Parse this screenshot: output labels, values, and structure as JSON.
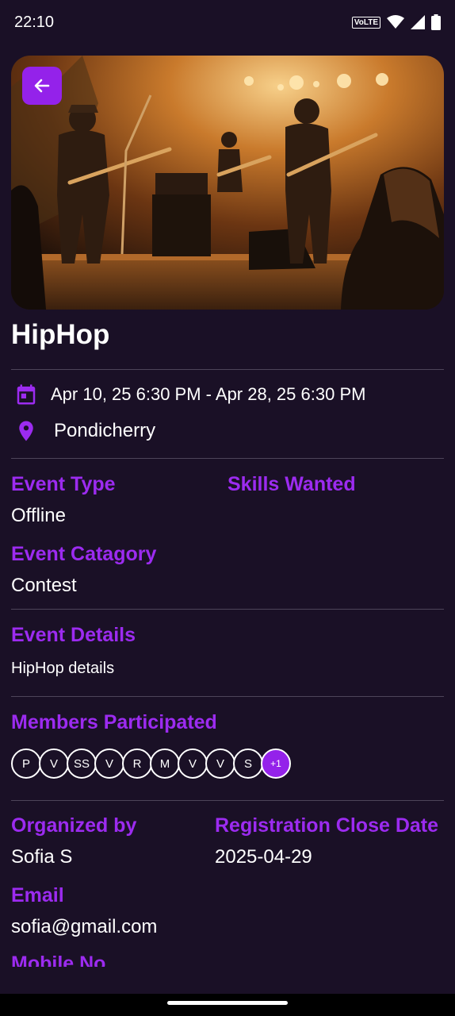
{
  "status_bar": {
    "time": "22:10",
    "volte": "VoLTE"
  },
  "event": {
    "title": "HipHop",
    "date_range": "Apr 10, 25 6:30 PM - Apr 28, 25 6:30 PM",
    "location": "Pondicherry"
  },
  "labels": {
    "event_type": "Event Type",
    "skills_wanted": "Skills Wanted",
    "event_category": "Event Catagory",
    "event_details": "Event Details",
    "members_participated": "Members Participated",
    "organized_by": "Organized by",
    "registration_close_date": "Registration Close Date",
    "email": "Email",
    "mobile_no": "Mobile No"
  },
  "values": {
    "event_type": "Offline",
    "event_category": "Contest",
    "event_details": "HipHop details",
    "organized_by": "Sofia S",
    "registration_close_date": "2025-04-29",
    "email": "sofia@gmail.com"
  },
  "members": [
    "P",
    "V",
    "SS",
    "V",
    "R",
    "M",
    "V",
    "V",
    "S"
  ],
  "members_more": "+1",
  "colors": {
    "accent": "#9c2bf0",
    "background": "#1a1026"
  },
  "icons": {
    "back": "arrow-left-icon",
    "calendar": "calendar-icon",
    "location": "location-pin-icon"
  }
}
